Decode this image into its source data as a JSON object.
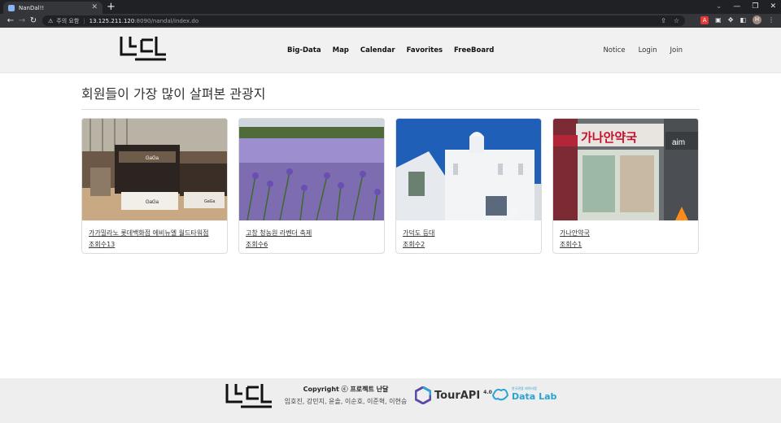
{
  "browser": {
    "tab_title": "NanDal!!",
    "new_tab": "+",
    "security_label": "주의 요함",
    "url_host": "13.125.211.120",
    "url_path": ":8090/nandal/index.do",
    "profile_initial": "H",
    "ext_label": "A"
  },
  "header": {
    "nav": [
      "Big-Data",
      "Map",
      "Calendar",
      "Favorites",
      "FreeBoard"
    ],
    "aux": [
      "Notice",
      "Login",
      "Join"
    ]
  },
  "main": {
    "title": "회원들이 가장 많이 살펴본 관광지",
    "cards": [
      {
        "title": "가가밀라노 롯데백화점 에비뉴엘 월드타워점",
        "views_label": "조회수",
        "views": "13"
      },
      {
        "title": "고창 청농원 라벤더 축제",
        "views_label": "조회수",
        "views": "6"
      },
      {
        "title": "가덕도 등대",
        "views_label": "조회수",
        "views": "2"
      },
      {
        "title": "가나안약국",
        "views_label": "조회수",
        "views": "1"
      }
    ],
    "photo_text": {
      "shop_sign": "GaGa",
      "pharmacy_sign": "가나안약국",
      "pharmacy_side": "aim",
      "lighthouse_watermark": "ⓒ"
    }
  },
  "footer": {
    "copyright": "Copyright ⓒ 프로젝트 난달",
    "members": "임호진, 강민지, 윤솔, 이순호, 이준혁, 이현승",
    "tourapi": "TourAPI",
    "tourapi_version": "4.0",
    "datalab": "Data Lab",
    "datalab_sub": "한국관광 데이터랩"
  },
  "colors": {
    "header_bg": "#f1f1f1",
    "footer_bg": "#eeeeee",
    "datalab_blue": "#29a3d4",
    "chrome_dark": "#202124"
  }
}
